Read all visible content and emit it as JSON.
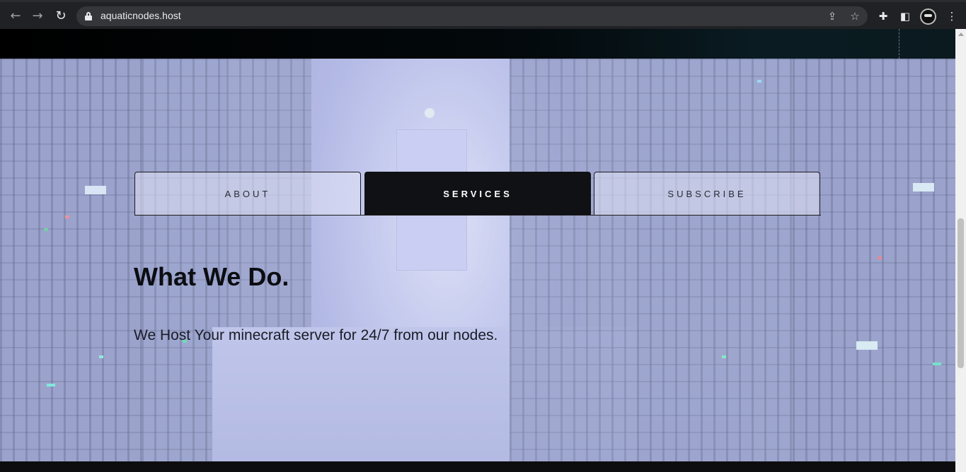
{
  "browser": {
    "back_glyph": "←",
    "forward_glyph": "→",
    "reload_glyph": "↻",
    "url": "aquaticnodes.host",
    "share_glyph": "⇪",
    "star_glyph": "☆",
    "extensions_glyph": "✚",
    "sidepanel_glyph": "◧",
    "menu_glyph": "⋮"
  },
  "tabs": [
    {
      "label": "ABOUT",
      "active": false
    },
    {
      "label": "SERVICES",
      "active": true
    },
    {
      "label": "SUBSCRIBE",
      "active": false
    }
  ],
  "section": {
    "title": "What We Do.",
    "description": "We Host Your minecraft server for 24/7 from our nodes."
  },
  "colors": {
    "active_tab": "#101114",
    "hero_tint": "#b9bfe0",
    "chrome": "#202124"
  }
}
